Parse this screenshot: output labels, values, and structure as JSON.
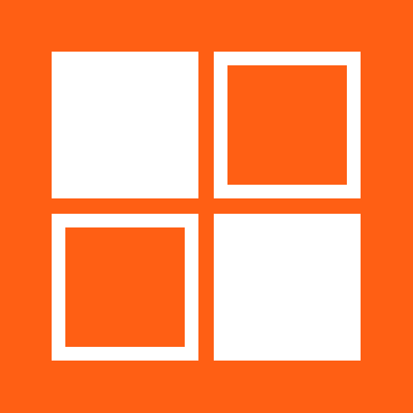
{
  "icon": {
    "name": "grid-icon",
    "colors": {
      "background": "#ff5f14",
      "foreground": "#ffffff"
    },
    "tiles": [
      {
        "position": "top-left",
        "style": "filled"
      },
      {
        "position": "top-right",
        "style": "outlined"
      },
      {
        "position": "bottom-left",
        "style": "outlined"
      },
      {
        "position": "bottom-right",
        "style": "filled"
      }
    ]
  }
}
